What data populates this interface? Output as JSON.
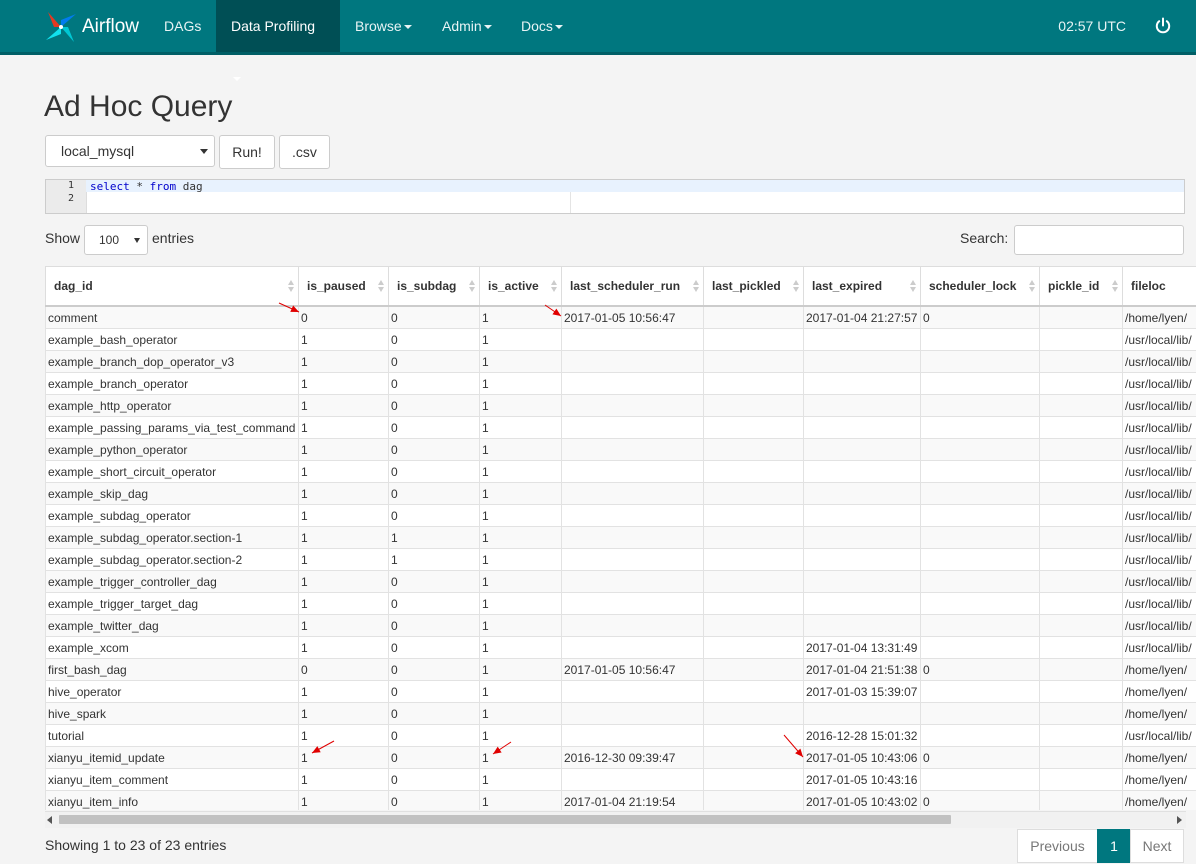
{
  "navbar": {
    "brand": "Airflow",
    "items": [
      {
        "label": "DAGs"
      },
      {
        "label": "Data Profiling"
      },
      {
        "label": "Browse"
      },
      {
        "label": "Admin"
      },
      {
        "label": "Docs"
      }
    ],
    "time": "02:57 UTC",
    "accent_color": "#00777f"
  },
  "page": {
    "title": "Ad Hoc Query",
    "connection": "local_mysql",
    "run_label": "Run!",
    "csv_label": ".csv",
    "query_line1": "select * from dag",
    "line_numbers": [
      "1",
      "2"
    ]
  },
  "controls": {
    "show_label": "Show",
    "entries_value": "100",
    "entries_label": "entries",
    "search_label": "Search:"
  },
  "table": {
    "columns": [
      "dag_id",
      "is_paused",
      "is_subdag",
      "is_active",
      "last_scheduler_run",
      "last_pickled",
      "last_expired",
      "scheduler_lock",
      "pickle_id",
      "fileloc"
    ],
    "rows": [
      [
        "comment",
        "0",
        "0",
        "1",
        "2017-01-05 10:56:47",
        "",
        "2017-01-04 21:27:57",
        "0",
        "",
        "/home/lyen/"
      ],
      [
        "example_bash_operator",
        "1",
        "0",
        "1",
        "",
        "",
        "",
        "",
        "",
        "/usr/local/lib/"
      ],
      [
        "example_branch_dop_operator_v3",
        "1",
        "0",
        "1",
        "",
        "",
        "",
        "",
        "",
        "/usr/local/lib/"
      ],
      [
        "example_branch_operator",
        "1",
        "0",
        "1",
        "",
        "",
        "",
        "",
        "",
        "/usr/local/lib/"
      ],
      [
        "example_http_operator",
        "1",
        "0",
        "1",
        "",
        "",
        "",
        "",
        "",
        "/usr/local/lib/"
      ],
      [
        "example_passing_params_via_test_command",
        "1",
        "0",
        "1",
        "",
        "",
        "",
        "",
        "",
        "/usr/local/lib/"
      ],
      [
        "example_python_operator",
        "1",
        "0",
        "1",
        "",
        "",
        "",
        "",
        "",
        "/usr/local/lib/"
      ],
      [
        "example_short_circuit_operator",
        "1",
        "0",
        "1",
        "",
        "",
        "",
        "",
        "",
        "/usr/local/lib/"
      ],
      [
        "example_skip_dag",
        "1",
        "0",
        "1",
        "",
        "",
        "",
        "",
        "",
        "/usr/local/lib/"
      ],
      [
        "example_subdag_operator",
        "1",
        "0",
        "1",
        "",
        "",
        "",
        "",
        "",
        "/usr/local/lib/"
      ],
      [
        "example_subdag_operator.section-1",
        "1",
        "1",
        "1",
        "",
        "",
        "",
        "",
        "",
        "/usr/local/lib/"
      ],
      [
        "example_subdag_operator.section-2",
        "1",
        "1",
        "1",
        "",
        "",
        "",
        "",
        "",
        "/usr/local/lib/"
      ],
      [
        "example_trigger_controller_dag",
        "1",
        "0",
        "1",
        "",
        "",
        "",
        "",
        "",
        "/usr/local/lib/"
      ],
      [
        "example_trigger_target_dag",
        "1",
        "0",
        "1",
        "",
        "",
        "",
        "",
        "",
        "/usr/local/lib/"
      ],
      [
        "example_twitter_dag",
        "1",
        "0",
        "1",
        "",
        "",
        "",
        "",
        "",
        "/usr/local/lib/"
      ],
      [
        "example_xcom",
        "1",
        "0",
        "1",
        "",
        "",
        "2017-01-04 13:31:49",
        "",
        "",
        "/usr/local/lib/"
      ],
      [
        "first_bash_dag",
        "0",
        "0",
        "1",
        "2017-01-05 10:56:47",
        "",
        "2017-01-04 21:51:38",
        "0",
        "",
        "/home/lyen/"
      ],
      [
        "hive_operator",
        "1",
        "0",
        "1",
        "",
        "",
        "2017-01-03 15:39:07",
        "",
        "",
        "/home/lyen/"
      ],
      [
        "hive_spark",
        "1",
        "0",
        "1",
        "",
        "",
        "",
        "",
        "",
        "/home/lyen/"
      ],
      [
        "tutorial",
        "1",
        "0",
        "1",
        "",
        "",
        "2016-12-28 15:01:32",
        "",
        "",
        "/usr/local/lib/"
      ],
      [
        "xianyu_itemid_update",
        "1",
        "0",
        "1",
        "2016-12-30 09:39:47",
        "",
        "2017-01-05 10:43:06",
        "0",
        "",
        "/home/lyen/"
      ],
      [
        "xianyu_item_comment",
        "1",
        "0",
        "1",
        "",
        "",
        "2017-01-05 10:43:16",
        "",
        "",
        "/home/lyen/"
      ],
      [
        "xianyu_item_info",
        "1",
        "0",
        "1",
        "2017-01-04 21:19:54",
        "",
        "2017-01-05 10:43:02",
        "0",
        "",
        "/home/lyen/"
      ]
    ]
  },
  "footer": {
    "info": "Showing 1 to 23 of 23 entries",
    "previous": "Previous",
    "page": "1",
    "next": "Next"
  },
  "annotation_color": "#e00000"
}
